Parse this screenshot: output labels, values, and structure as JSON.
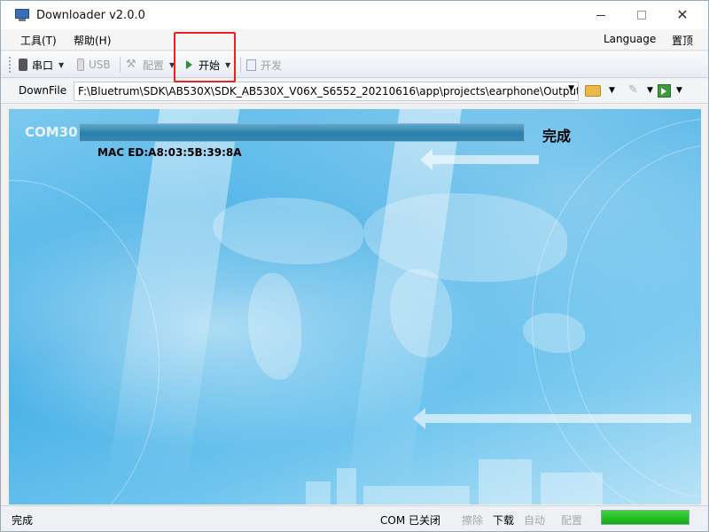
{
  "window": {
    "title": "Downloader v2.0.0"
  },
  "menu": {
    "tools": "工具(T)",
    "help": "帮助(H)",
    "language": "Language",
    "top": "置顶"
  },
  "toolbar": {
    "serial": "串口",
    "usb": "USB",
    "config": "配置",
    "start": "开始",
    "develop": "开发"
  },
  "pathbar": {
    "label": "DownFile",
    "path": "F:\\Bluetrum\\SDK\\AB530X\\SDK_AB530X_V06X_S6552_20210616\\app\\projects\\earphone\\Output\\"
  },
  "main": {
    "port": "COM30",
    "progress": 1.0,
    "status": "完成",
    "mac": "MAC ED:A8:03:5B:39:8A"
  },
  "statusbar": {
    "status": "完成",
    "com_state": "COM 已关闭",
    "erase": "擦除",
    "download": "下载",
    "auto": "自动",
    "config": "配置",
    "progress": 1.0
  },
  "colors": {
    "accent_highlight": "#e8221f",
    "progress_green": "#10a810",
    "panel_blue": "#43aee6"
  },
  "icons": [
    "app-icon",
    "serial-icon",
    "usb-icon",
    "tools-icon",
    "play-icon",
    "doc-icon",
    "folder-icon",
    "pen-icon",
    "export-icon"
  ]
}
